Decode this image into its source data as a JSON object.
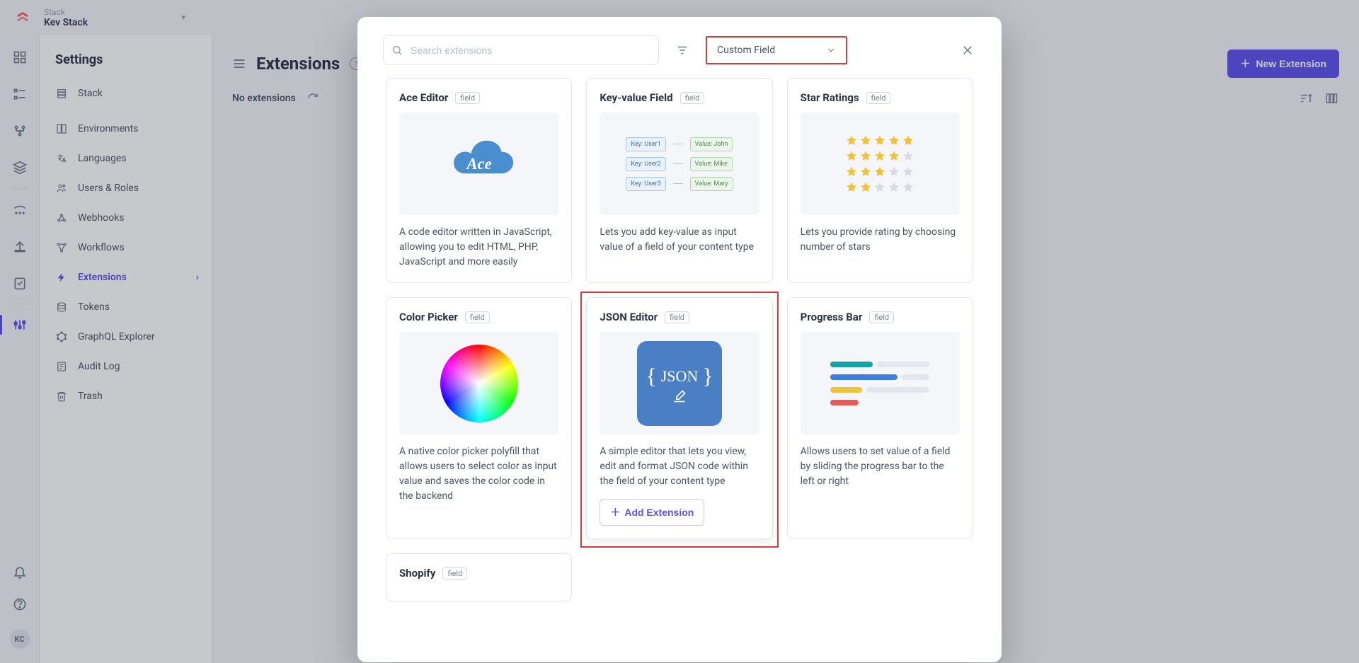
{
  "topbar": {
    "label": "Stack",
    "name": "Kev Stack"
  },
  "sidebar": {
    "title": "Settings",
    "items": [
      {
        "label": "Stack"
      },
      {
        "label": "Environments"
      },
      {
        "label": "Languages"
      },
      {
        "label": "Users & Roles"
      },
      {
        "label": "Webhooks"
      },
      {
        "label": "Workflows"
      },
      {
        "label": "Extensions"
      },
      {
        "label": "Tokens"
      },
      {
        "label": "GraphQL Explorer"
      },
      {
        "label": "Audit Log"
      },
      {
        "label": "Trash"
      }
    ]
  },
  "main": {
    "title": "Extensions",
    "new_btn": "New Extension",
    "empty": "No extensions"
  },
  "modal": {
    "search_placeholder": "Search extensions",
    "filter_value": "Custom Field",
    "add_label": "Add Extension",
    "tag": "field",
    "cards": [
      {
        "title": "Ace Editor",
        "desc": "A code editor written in JavaScript, allowing you to edit HTML, PHP, JavaScript and more easily"
      },
      {
        "title": "Key-value Field",
        "desc": "Lets you add key-value as input value of a field of your content type"
      },
      {
        "title": "Star Ratings",
        "desc": "Lets you provide rating by choosing number of stars"
      },
      {
        "title": "Color Picker",
        "desc": "A native color picker polyfill that allows users to select color as input value and saves the color code in the backend"
      },
      {
        "title": "JSON Editor",
        "desc": "A simple editor that lets you view, edit and format JSON code within the field of your content type"
      },
      {
        "title": "Progress Bar",
        "desc": "Allows users to set value of a field by sliding the progress bar to the left or right"
      },
      {
        "title": "Shopify",
        "desc": ""
      }
    ],
    "kv": [
      {
        "k": "Key: User1",
        "v": "Value: John"
      },
      {
        "k": "Key: User2",
        "v": "Value: Mike"
      },
      {
        "k": "Key: User3",
        "v": "Value: Mary"
      }
    ]
  },
  "avatar": "KC"
}
